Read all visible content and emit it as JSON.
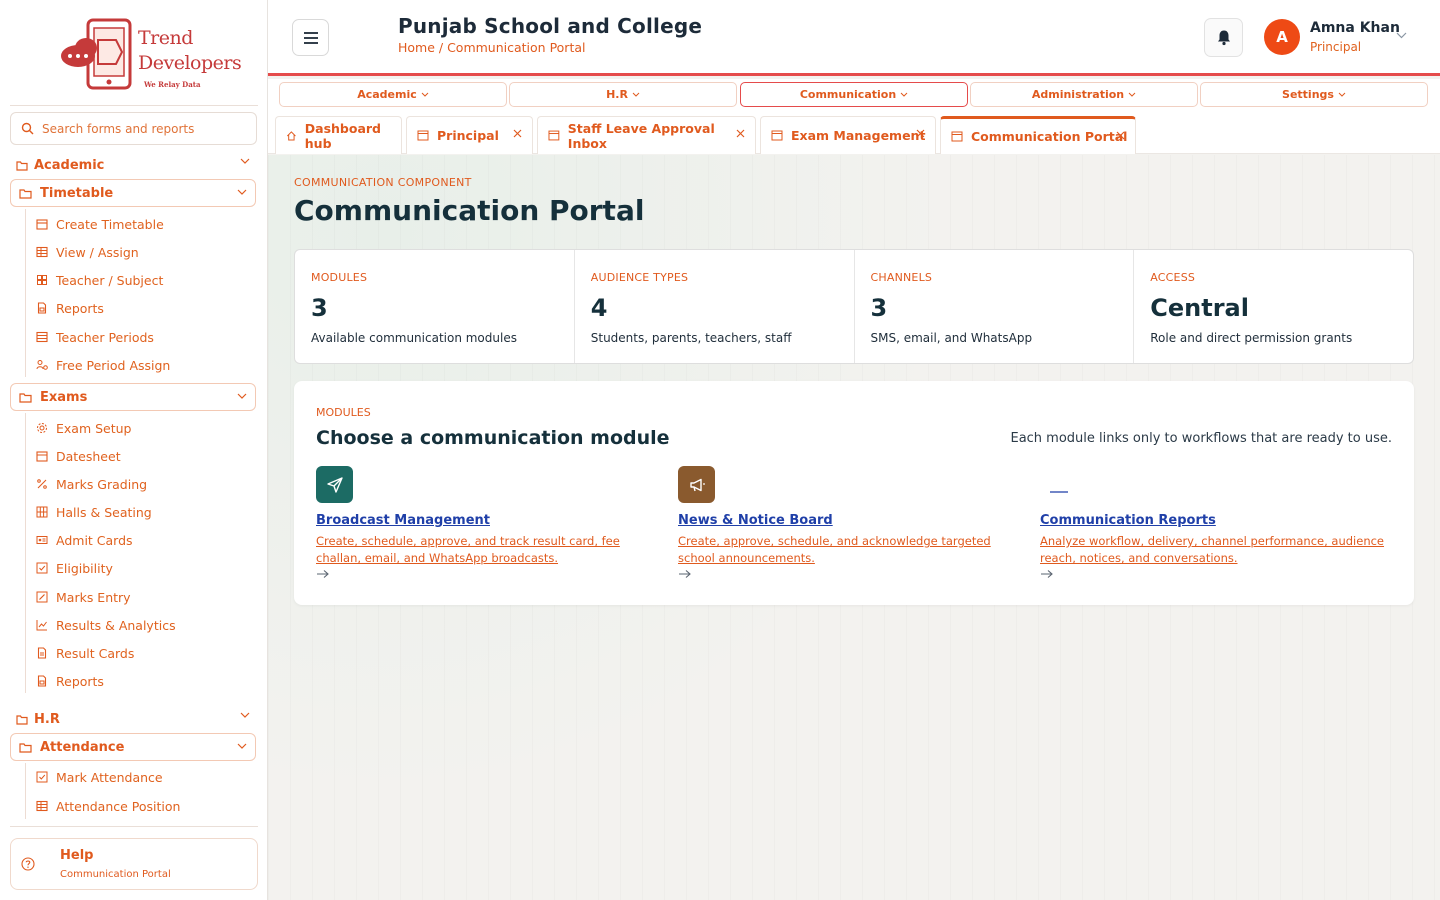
{
  "brand": {
    "name_line1": "Trend",
    "name_line2": "Developers",
    "tagline": "We Relay Data"
  },
  "sidebar": {
    "search_placeholder": "Search forms and reports",
    "sections": [
      {
        "label": "Academic"
      },
      {
        "label": "H.R"
      }
    ],
    "groups": [
      {
        "label": "Timetable",
        "items": [
          "Create Timetable",
          "View / Assign",
          "Teacher / Subject",
          "Reports",
          "Teacher Periods",
          "Free Period Assign"
        ]
      },
      {
        "label": "Exams",
        "items": [
          "Exam Setup",
          "Datesheet",
          "Marks Grading",
          "Halls & Seating",
          "Admit Cards",
          "Eligibility",
          "Marks Entry",
          "Results & Analytics",
          "Result Cards",
          "Reports"
        ]
      },
      {
        "label": "Attendance",
        "items": [
          "Mark Attendance",
          "Attendance Position"
        ]
      }
    ],
    "help": {
      "title": "Help",
      "subtitle": "Communication Portal"
    }
  },
  "header": {
    "school_name": "Punjab School and College",
    "breadcrumb": "Home / Communication Portal",
    "user": {
      "initial": "A",
      "name": "Amna Khan",
      "role": "Principal"
    }
  },
  "top_menu": [
    {
      "label": "Academic"
    },
    {
      "label": "H.R"
    },
    {
      "label": "Communication",
      "active": true
    },
    {
      "label": "Administration"
    },
    {
      "label": "Settings"
    }
  ],
  "tabs": [
    {
      "label": "Dashboard hub",
      "icon": "home-icon",
      "closable": false
    },
    {
      "label": "Principal",
      "icon": "window-icon",
      "closable": true
    },
    {
      "label": "Staff Leave Approval Inbox",
      "icon": "window-icon",
      "closable": true
    },
    {
      "label": "Exam Management",
      "icon": "window-icon",
      "closable": true
    },
    {
      "label": "Communication Portal",
      "icon": "window-icon",
      "closable": true,
      "active": true
    }
  ],
  "page": {
    "eyebrow": "COMMUNICATION COMPONENT",
    "title": "Communication Portal",
    "stats": [
      {
        "label": "MODULES",
        "value": "3",
        "desc": "Available communication modules"
      },
      {
        "label": "AUDIENCE TYPES",
        "value": "4",
        "desc": "Students, parents, teachers, staff"
      },
      {
        "label": "CHANNELS",
        "value": "3",
        "desc": "SMS, email, and WhatsApp"
      },
      {
        "label": "ACCESS",
        "value": "Central",
        "desc": "Role and direct permission grants"
      }
    ],
    "modules": {
      "eyebrow": "MODULES",
      "title": "Choose a communication module",
      "note": "Each module links only to workflows that are ready to use.",
      "items": [
        {
          "name": "Broadcast Management",
          "desc": "Create, schedule, approve, and track result card, fee challan, email, and WhatsApp broadcasts.",
          "icon": "paper-plane-icon",
          "color": "#1c6b64"
        },
        {
          "name": "News & Notice Board",
          "desc": "Create, approve, schedule, and acknowledge targeted school announcements.",
          "icon": "megaphone-icon",
          "color": "#8a5a2e"
        },
        {
          "name": "Communication Reports",
          "desc": "Analyze workflow, delivery, channel performance, audience reach, notices, and conversations.",
          "icon": "chart-icon",
          "color": "#ffffff"
        }
      ]
    }
  },
  "colors": {
    "accent": "#e05a1e",
    "header_rule": "#e54b4b",
    "title": "#15303b",
    "link": "#1f3fa8"
  }
}
